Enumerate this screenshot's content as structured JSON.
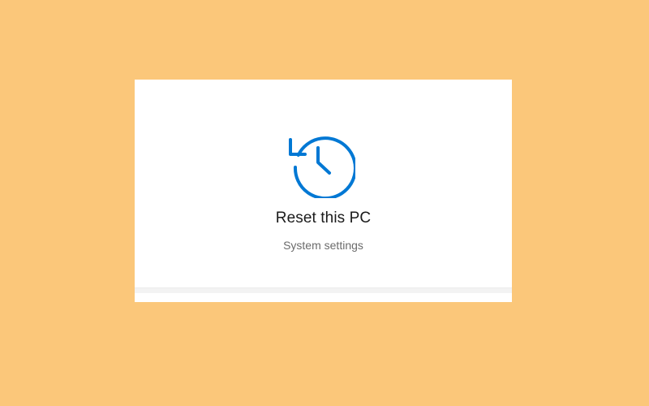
{
  "result": {
    "icon": "history-reset-icon",
    "title": "Reset this PC",
    "subtitle": "System settings"
  },
  "colors": {
    "background": "#fbc77a",
    "accent": "#0078d4",
    "panel": "#ffffff"
  }
}
